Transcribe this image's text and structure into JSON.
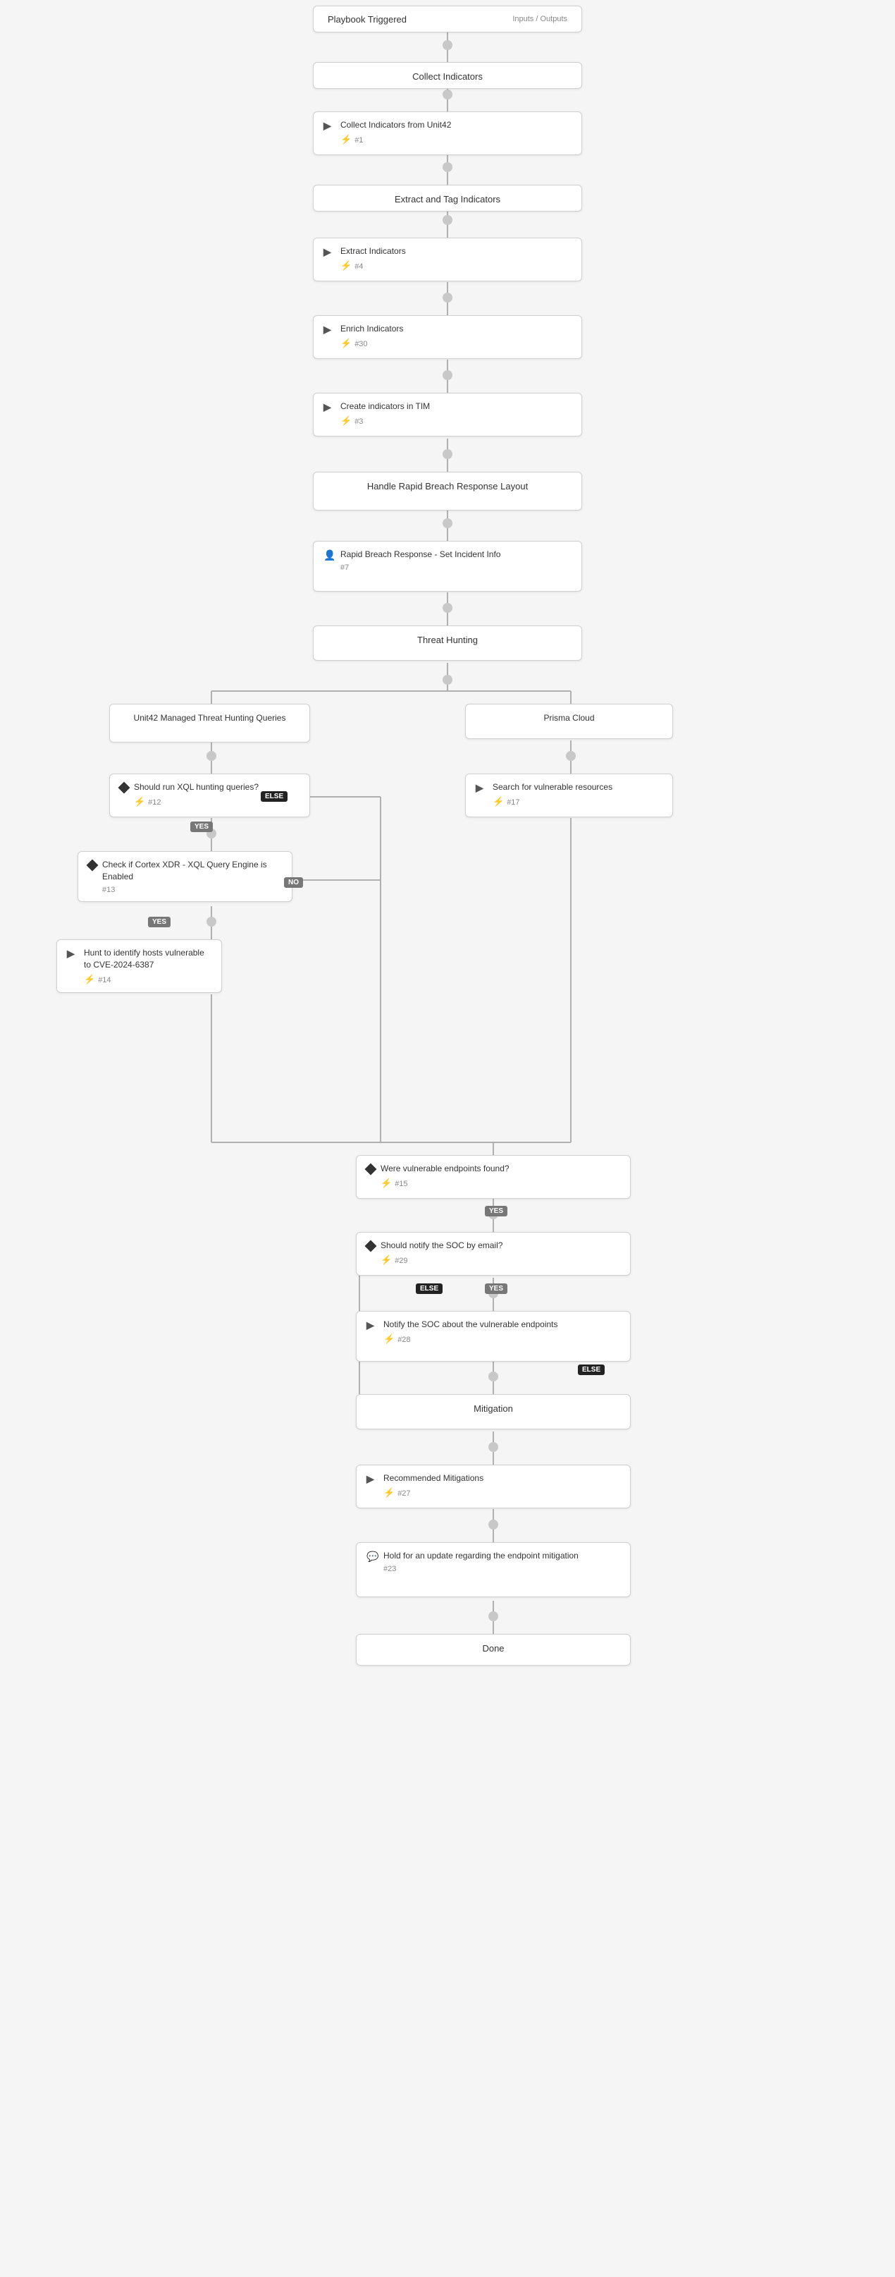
{
  "nodes": {
    "playbook_triggered": {
      "label": "Playbook Triggered",
      "sub_label": "Inputs / Outputs",
      "id": "playbook-triggered"
    },
    "collect_indicators": {
      "label": "Collect Indicators",
      "id": "collect-indicators"
    },
    "collect_indicators_unit42": {
      "label": "Collect Indicators from Unit42",
      "number": "#1",
      "icon": "arrow-right",
      "id": "collect-indicators-unit42"
    },
    "extract_tag_indicators": {
      "label": "Extract and Tag Indicators",
      "id": "extract-tag-indicators"
    },
    "extract_indicators": {
      "label": "Extract Indicators",
      "number": "#4",
      "icon": "arrow-right",
      "id": "extract-indicators"
    },
    "enrich_indicators": {
      "label": "Enrich Indicators",
      "number": "#30",
      "icon": "arrow-right",
      "id": "enrich-indicators"
    },
    "create_indicators_tim": {
      "label": "Create indicators in TIM",
      "number": "#3",
      "icon": "arrow-right",
      "id": "create-indicators-tim"
    },
    "handle_rapid_breach": {
      "label": "Handle Rapid Breach Response Layout",
      "id": "handle-rapid-breach"
    },
    "rapid_breach_set_incident": {
      "label": "Rapid Breach Response - Set Incident Info",
      "number": "#7",
      "icon": "person",
      "id": "rapid-breach-set-incident"
    },
    "threat_hunting": {
      "label": "Threat Hunting",
      "id": "threat-hunting"
    },
    "unit42_managed": {
      "label": "Unit42 Managed Threat Hunting Queries",
      "id": "unit42-managed"
    },
    "prisma_cloud": {
      "label": "Prisma Cloud",
      "id": "prisma-cloud"
    },
    "should_run_xql": {
      "label": "Should run XQL hunting queries?",
      "number": "#12",
      "icon": "diamond",
      "id": "should-run-xql"
    },
    "search_vulnerable": {
      "label": "Search for vulnerable resources",
      "number": "#17",
      "icon": "arrow-right",
      "id": "search-vulnerable"
    },
    "check_cortex_xdr": {
      "label": "Check if Cortex XDR - XQL Query Engine is Enabled",
      "number": "#13",
      "icon": "diamond",
      "id": "check-cortex-xdr"
    },
    "hunt_identify_hosts": {
      "label": "Hunt to identify hosts vulnerable to CVE-2024-6387",
      "number": "#14",
      "icon": "arrow-right",
      "id": "hunt-identify-hosts"
    },
    "were_vulnerable_found": {
      "label": "Were vulnerable endpoints found?",
      "number": "#15",
      "icon": "diamond",
      "id": "were-vulnerable-found"
    },
    "should_notify_soc": {
      "label": "Should notify the SOC by email?",
      "number": "#29",
      "icon": "diamond",
      "id": "should-notify-soc"
    },
    "notify_soc": {
      "label": "Notify the SOC about the vulnerable endpoints",
      "number": "#28",
      "icon": "arrow-right",
      "id": "notify-soc"
    },
    "mitigation": {
      "label": "Mitigation",
      "id": "mitigation"
    },
    "recommended_mitigations": {
      "label": "Recommended Mitigations",
      "number": "#27",
      "icon": "arrow-right",
      "id": "recommended-mitigations"
    },
    "hold_update": {
      "label": "Hold for an update regarding the endpoint mitigation",
      "number": "#23",
      "icon": "chat",
      "id": "hold-update"
    },
    "done": {
      "label": "Done",
      "id": "done"
    }
  },
  "badges": {
    "yes": "YES",
    "no": "NO",
    "else": "ELSE"
  },
  "colors": {
    "node_border": "#d0d0d0",
    "node_bg": "#ffffff",
    "connector": "#b0b0b0",
    "badge_dark": "#222222",
    "badge_mid": "#777777",
    "bolt_color": "#f5a623",
    "section_bg": "#f8f8f8"
  }
}
